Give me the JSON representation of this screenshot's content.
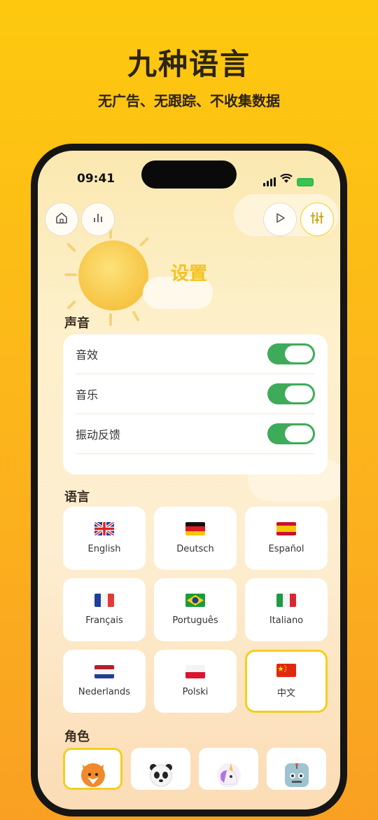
{
  "promo": {
    "headline": "九种语言",
    "subline": "无广告、无跟踪、不收集数据"
  },
  "status_bar": {
    "time": "09:41"
  },
  "top_bar": {
    "left_buttons": [
      "home-icon",
      "bar-chart-icon"
    ],
    "right_buttons": [
      "play-icon",
      "sliders-icon"
    ]
  },
  "page": {
    "title": "设置"
  },
  "sound": {
    "label": "声音",
    "items": [
      {
        "label": "音效",
        "enabled": true
      },
      {
        "label": "音乐",
        "enabled": true
      },
      {
        "label": "振动反馈",
        "enabled": true
      }
    ]
  },
  "language": {
    "label": "语言",
    "selected": "中文",
    "options": [
      {
        "label": "English",
        "flag": "uk-flag-icon"
      },
      {
        "label": "Deutsch",
        "flag": "germany-flag-icon"
      },
      {
        "label": "Español",
        "flag": "spain-flag-icon"
      },
      {
        "label": "Français",
        "flag": "france-flag-icon"
      },
      {
        "label": "Português",
        "flag": "brazil-flag-icon"
      },
      {
        "label": "Italiano",
        "flag": "italy-flag-icon"
      },
      {
        "label": "Nederlands",
        "flag": "netherlands-flag-icon"
      },
      {
        "label": "Polski",
        "flag": "poland-flag-icon"
      },
      {
        "label": "中文",
        "flag": "china-flag-icon"
      }
    ]
  },
  "character": {
    "label": "角色",
    "options": [
      "fox-icon",
      "panda-icon",
      "unicorn-icon",
      "robot-icon"
    ],
    "selected": "fox-icon"
  },
  "colors": {
    "accent": "#f3cf1f",
    "toggle_on": "#3eab5a",
    "background_top": "#fdc90f",
    "background_bottom": "#f9a023"
  }
}
